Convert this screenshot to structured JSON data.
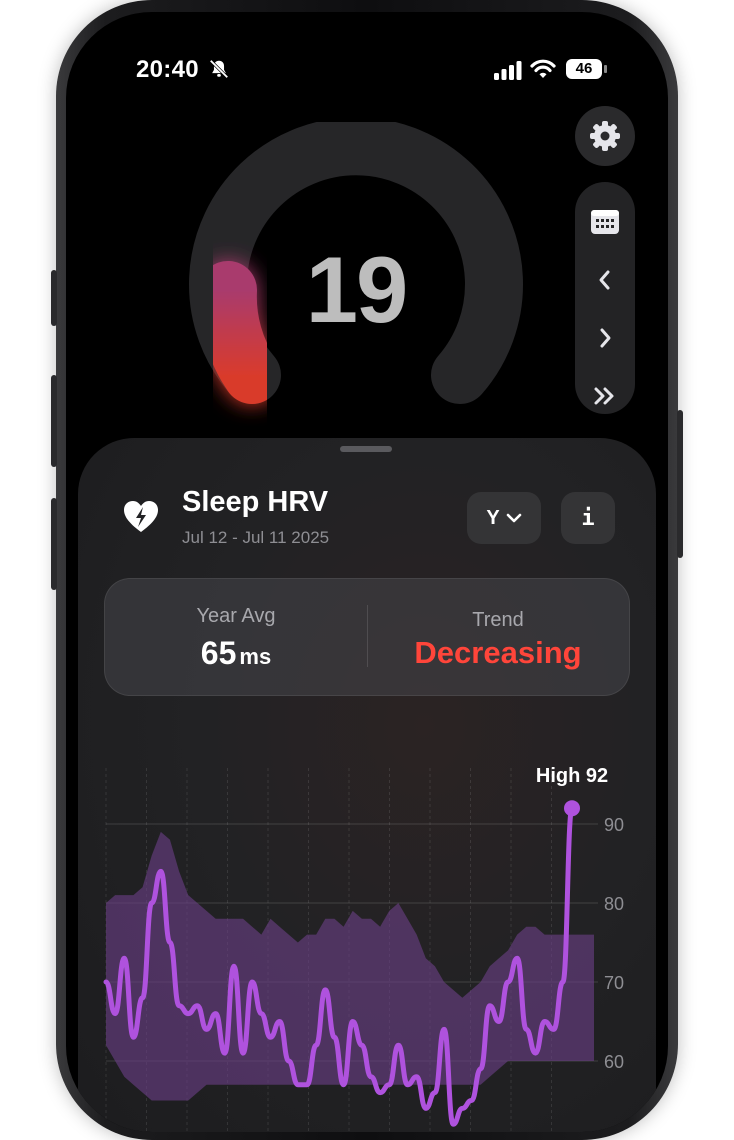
{
  "status_bar": {
    "time": "20:40",
    "battery": "46",
    "silent_icon": "bell-slash-icon",
    "signal_icon": "cellular-signal-icon",
    "wifi_icon": "wifi-icon"
  },
  "gauge": {
    "score": "19",
    "arc_color": "#d13a32"
  },
  "controls": {
    "settings_icon": "gear-icon",
    "calendar_icon": "calendar-icon",
    "prev_icon": "chevron-left-icon",
    "next_icon": "chevron-right-icon",
    "latest_icon": "double-chevron-right-icon"
  },
  "sheet": {
    "title": "Sleep HRV",
    "date_range": "Jul 12 - Jul 11 2025",
    "heart_icon": "heart-bolt-icon",
    "range_selector": "Y",
    "info_label": "i",
    "stats": {
      "avg_label": "Year Avg",
      "avg_value": "65",
      "avg_unit": "ms",
      "trend_label": "Trend",
      "trend_value": "Decreasing",
      "trend_color": "#ff453a"
    }
  },
  "chart_data": {
    "type": "line",
    "annotation": "High 92",
    "y_ticks": [
      "90",
      "80",
      "70",
      "60"
    ],
    "ylim": [
      56,
      95
    ],
    "grid": true,
    "line_color": "#af52de",
    "band_color": "#6a3f86",
    "series": [
      {
        "values": [
          70,
          66,
          73,
          63,
          68,
          80,
          84,
          75,
          67,
          66,
          67,
          64,
          66,
          61,
          72,
          61,
          70,
          66,
          63,
          65,
          60,
          57,
          57,
          62,
          69,
          63,
          57,
          65,
          62,
          58,
          56,
          57,
          62,
          57,
          58,
          54,
          56,
          64,
          52,
          54,
          55,
          59,
          67,
          65,
          70,
          73,
          64,
          61,
          65,
          64,
          70,
          92
        ]
      }
    ],
    "band_upper": [
      80,
      81,
      81,
      81,
      82,
      86,
      89,
      88,
      84,
      81,
      80,
      79,
      78,
      78,
      78,
      78,
      77,
      76,
      78,
      77,
      76,
      75,
      76,
      76,
      78,
      78,
      77,
      79,
      78,
      78,
      77,
      79,
      80,
      78,
      76,
      73,
      72,
      70,
      69,
      68,
      69,
      70,
      72,
      73,
      74,
      76,
      77,
      77,
      76,
      76,
      76,
      76
    ],
    "band_lower": [
      62,
      60,
      58,
      57,
      56,
      55,
      55,
      55,
      55,
      55,
      56,
      57,
      57,
      57,
      57,
      57,
      57,
      57,
      57,
      57,
      57,
      57,
      57,
      57,
      57,
      57,
      57,
      57,
      57,
      57,
      57,
      57,
      57,
      57,
      57,
      57,
      57,
      57,
      57,
      57,
      57,
      57,
      58,
      59,
      60,
      60,
      60,
      60,
      60,
      60,
      60,
      60
    ]
  }
}
